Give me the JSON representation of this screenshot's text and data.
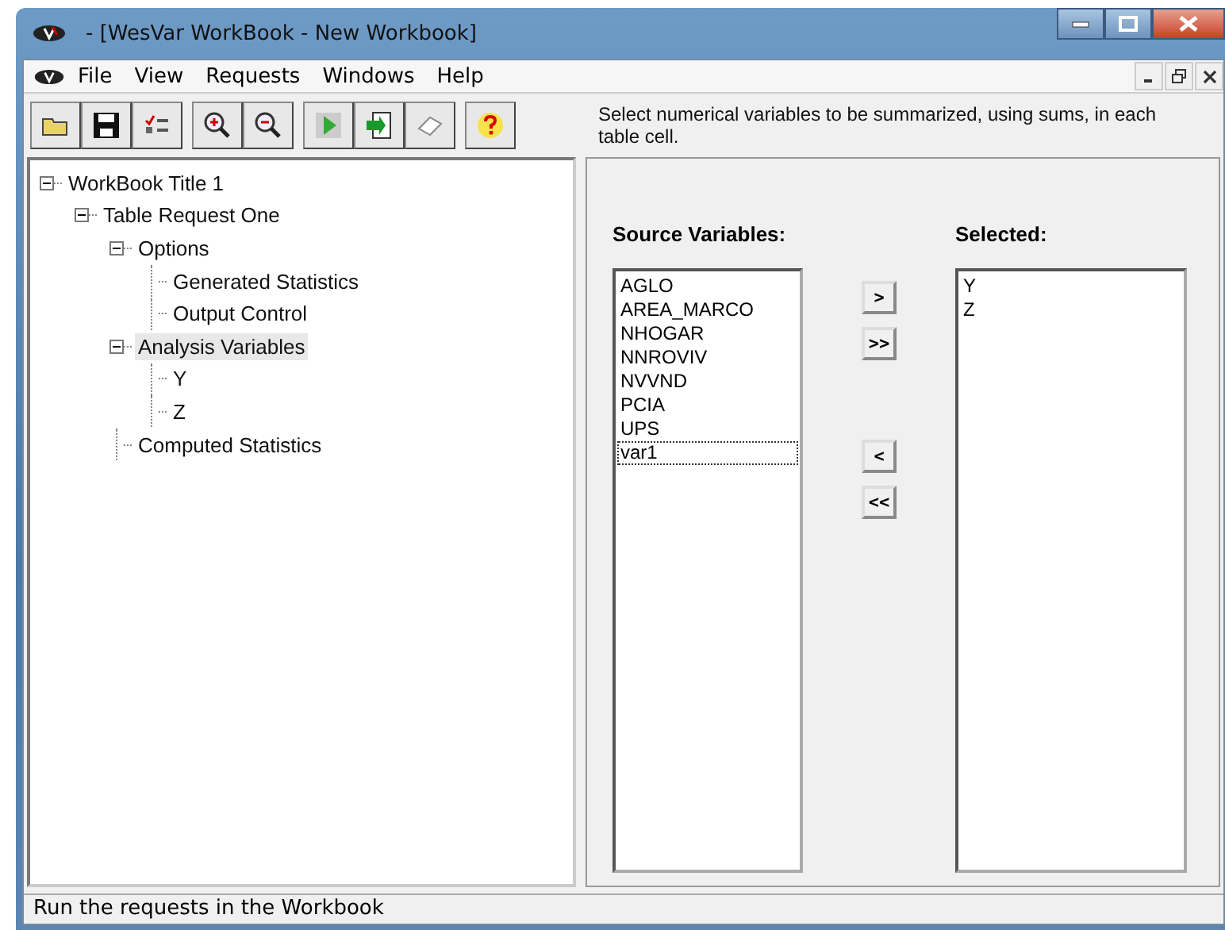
{
  "window": {
    "title": "- [WesVar WorkBook - New Workbook]"
  },
  "menu": [
    "File",
    "View",
    "Requests",
    "Windows",
    "Help"
  ],
  "toolbar": {
    "hint": "Select numerical variables to be summarized, using sums, in each table cell."
  },
  "tree": [
    {
      "label": "WorkBook Title 1",
      "expanded": true,
      "selected": false,
      "children": [
        {
          "label": "Table Request One",
          "expanded": true,
          "selected": false,
          "children": [
            {
              "label": "Options",
              "expanded": true,
              "selected": false,
              "children": [
                {
                  "label": "Generated Statistics",
                  "selected": false
                },
                {
                  "label": "Output Control",
                  "selected": false
                }
              ]
            },
            {
              "label": "Analysis Variables",
              "expanded": true,
              "selected": true,
              "children": [
                {
                  "label": "Y",
                  "selected": false
                },
                {
                  "label": "Z",
                  "selected": false
                }
              ]
            },
            {
              "label": "Computed Statistics",
              "selected": false
            }
          ]
        }
      ]
    }
  ],
  "source": {
    "heading": "Source Variables:",
    "items": [
      {
        "label": "AGLO",
        "selected": false
      },
      {
        "label": "AREA_MARCO",
        "selected": false
      },
      {
        "label": "NHOGAR",
        "selected": false
      },
      {
        "label": "NNROVIV",
        "selected": false
      },
      {
        "label": "NVVND",
        "selected": false
      },
      {
        "label": "PCIA",
        "selected": false
      },
      {
        "label": "UPS",
        "selected": false
      },
      {
        "label": "var1",
        "selected": true
      }
    ]
  },
  "move_buttons": [
    ">",
    ">>",
    "<",
    "<<"
  ],
  "selected_list": {
    "heading": "Selected:",
    "items": [
      "Y",
      "Z"
    ]
  },
  "status_bar": "Run the requests in the Workbook"
}
